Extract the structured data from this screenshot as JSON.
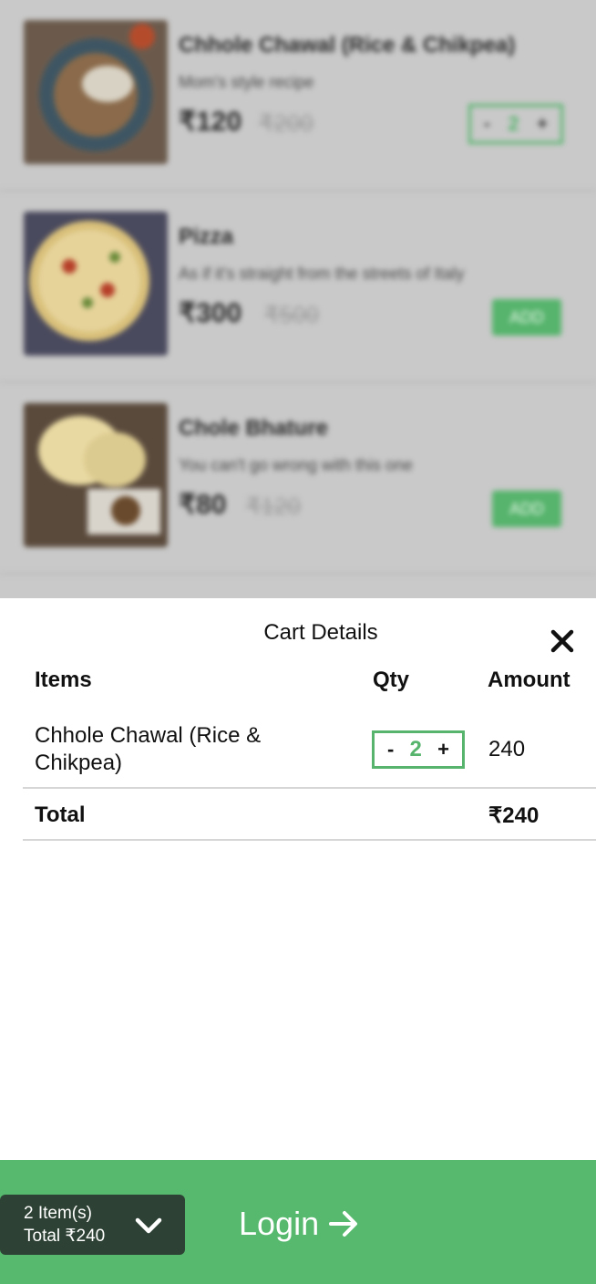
{
  "menu": {
    "items": [
      {
        "name": "Chhole Chawal (Rice & Chikpea)",
        "desc": "Mom's style recipe",
        "price": "₹120",
        "mrp": "₹200",
        "qty": "2",
        "minus": "-",
        "plus": "+"
      },
      {
        "name": "Pizza",
        "desc": "As if it's straight from the streets of Italy",
        "price": "₹300",
        "mrp": "₹500",
        "add_label": "ADD"
      },
      {
        "name": "Chole Bhature",
        "desc": "You can't go wrong with this one",
        "price": "₹80",
        "mrp": "₹120",
        "add_label": "ADD"
      }
    ]
  },
  "cart": {
    "title": "Cart Details",
    "close_icon": "close-icon",
    "headers": {
      "items": "Items",
      "qty": "Qty",
      "amount": "Amount"
    },
    "rows": [
      {
        "name": "Chhole Chawal (Rice & Chikpea)",
        "qty": "2",
        "minus": "-",
        "plus": "+",
        "amount": "240"
      }
    ],
    "total_label": "Total",
    "total_value": "₹240"
  },
  "bottom_bar": {
    "item_count": "2 Item(s)",
    "total": "Total ₹240",
    "chevron_icon": "chevron-down-icon",
    "login_label": "Login",
    "arrow_icon": "arrow-right-icon"
  },
  "colors": {
    "accent": "#56b96e",
    "summary_bg": "#2d4234",
    "qty_green": "#56b46c"
  }
}
